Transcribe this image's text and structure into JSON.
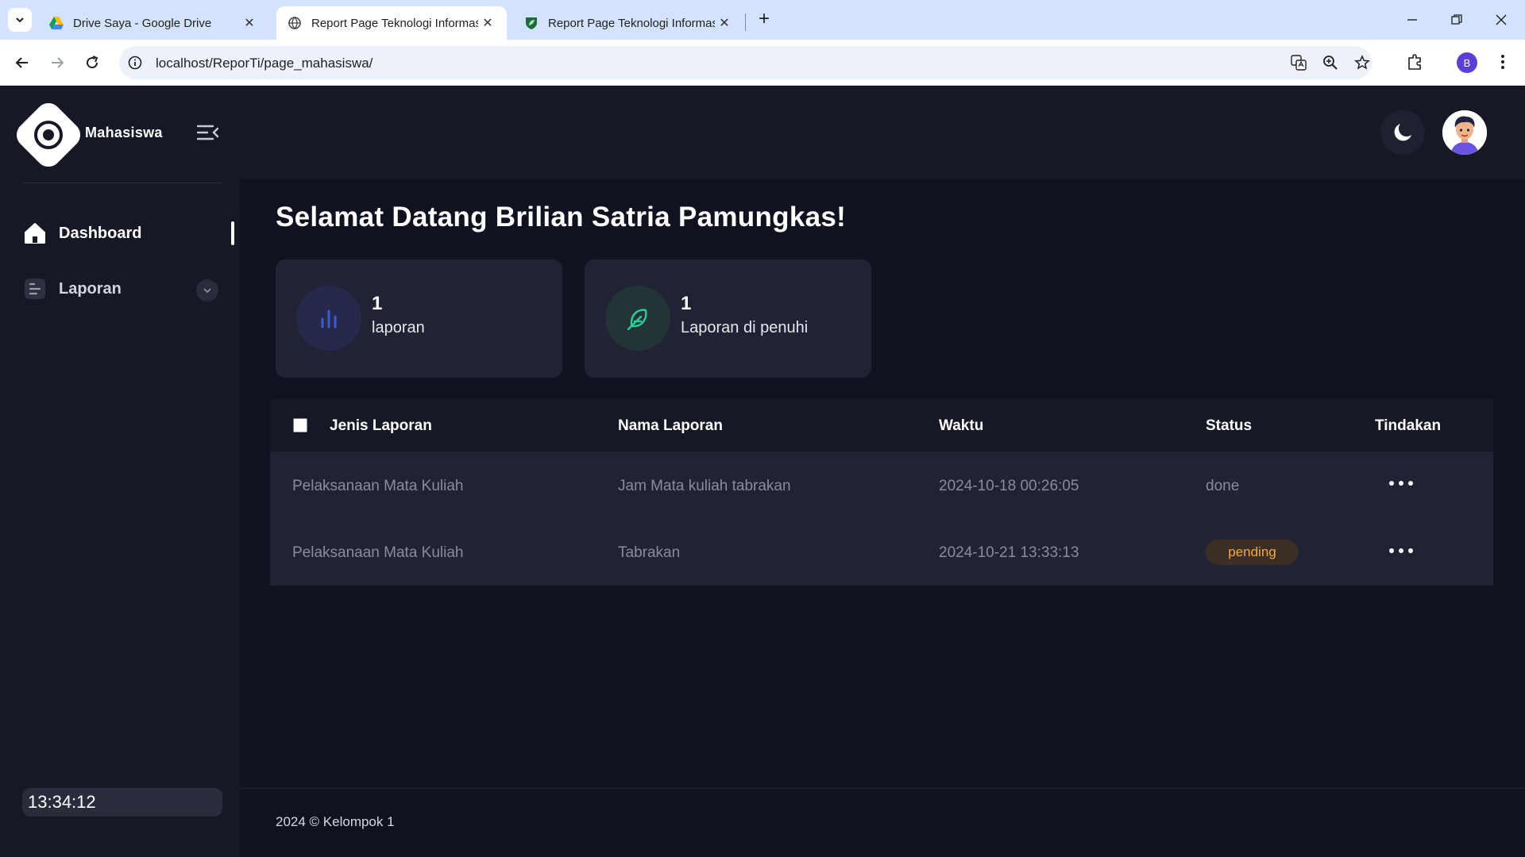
{
  "browser": {
    "tabs": [
      {
        "title": "Drive Saya - Google Drive",
        "favicon": "google-drive-icon",
        "active": false
      },
      {
        "title": "Report Page Teknologi Informasi",
        "favicon": "globe-icon",
        "active": true
      },
      {
        "title": "Report Page Teknologi Informasi",
        "favicon": "shield-leaf-icon",
        "active": false
      }
    ],
    "url": "localhost/ReporTi/page_mahasiswa/",
    "profile_initial": "B"
  },
  "sidebar": {
    "brand": "Mahasiswa",
    "items": [
      {
        "label": "Dashboard",
        "icon": "home-icon",
        "active": true
      },
      {
        "label": "Laporan",
        "icon": "list-icon",
        "expandable": true
      }
    ],
    "clock": "13:34:12"
  },
  "main": {
    "greeting": "Selamat Datang Brilian Satria Pamungkas!",
    "stats": [
      {
        "value": "1",
        "label": "laporan",
        "icon": "bar-chart-icon",
        "color": "#3b5bdb"
      },
      {
        "value": "1",
        "label": "Laporan di penuhi",
        "icon": "feather-icon",
        "color": "#2ecc9a"
      }
    ],
    "table": {
      "headers": [
        "Jenis Laporan",
        "Nama Laporan",
        "Waktu",
        "Status",
        "Tindakan"
      ],
      "rows": [
        {
          "jenis": "Pelaksanaan Mata Kuliah",
          "nama": "Jam Mata kuliah tabrakan",
          "waktu": "2024-10-18 00:26:05",
          "status": "done"
        },
        {
          "jenis": "Pelaksanaan Mata Kuliah",
          "nama": "Tabrakan",
          "waktu": "2024-10-21 13:33:13",
          "status": "pending"
        }
      ]
    }
  },
  "footer": {
    "text": "2024 © Kelompok 1"
  },
  "colors": {
    "background": "#111220",
    "sidebar": "#171826",
    "card": "#212233",
    "pending": "#f6a647"
  }
}
